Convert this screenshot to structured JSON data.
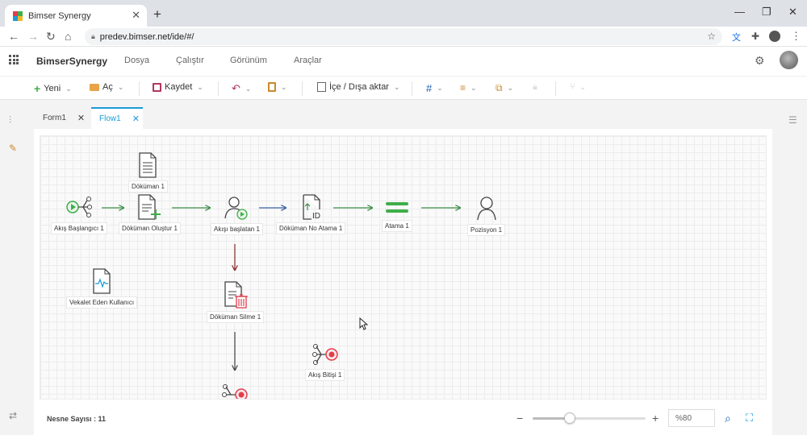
{
  "browser": {
    "tab_title": "Bimser Synergy",
    "new_tab": "+",
    "url": "predev.bimser.net/ide/#/"
  },
  "app": {
    "brand": "BimserSynergy",
    "menu": [
      "Dosya",
      "Çalıştır",
      "Görünüm",
      "Araçlar"
    ]
  },
  "toolbar": {
    "new_label": "Yeni",
    "open_label": "Aç",
    "save_label": "Kaydet",
    "import_export_label": "İçe / Dışa aktar"
  },
  "doc_tabs": [
    {
      "label": "Form1",
      "active": false
    },
    {
      "label": "Flow1",
      "active": true
    }
  ],
  "flow": {
    "nodes": {
      "doc1": "Döküman 1",
      "start": "Akış Başlangıcı 1",
      "create": "Döküman Oluştur 1",
      "initiator": "Akışı başlatan 1",
      "docno": "Döküman No Atama 1",
      "assign": "Atama 1",
      "position": "Pozisyon 1",
      "proxy": "Vekalet Eden Kullanıcı",
      "delete": "Döküman Silme 1",
      "end": "Akış Bitişi 1"
    }
  },
  "status": {
    "count_label": "Nesne Sayısı : 11",
    "zoom": "%80",
    "zoom_level_fraction": 0.33
  },
  "colors": {
    "accent": "#1a9bd7",
    "green": "#3fae49",
    "red": "#e23d4b"
  }
}
